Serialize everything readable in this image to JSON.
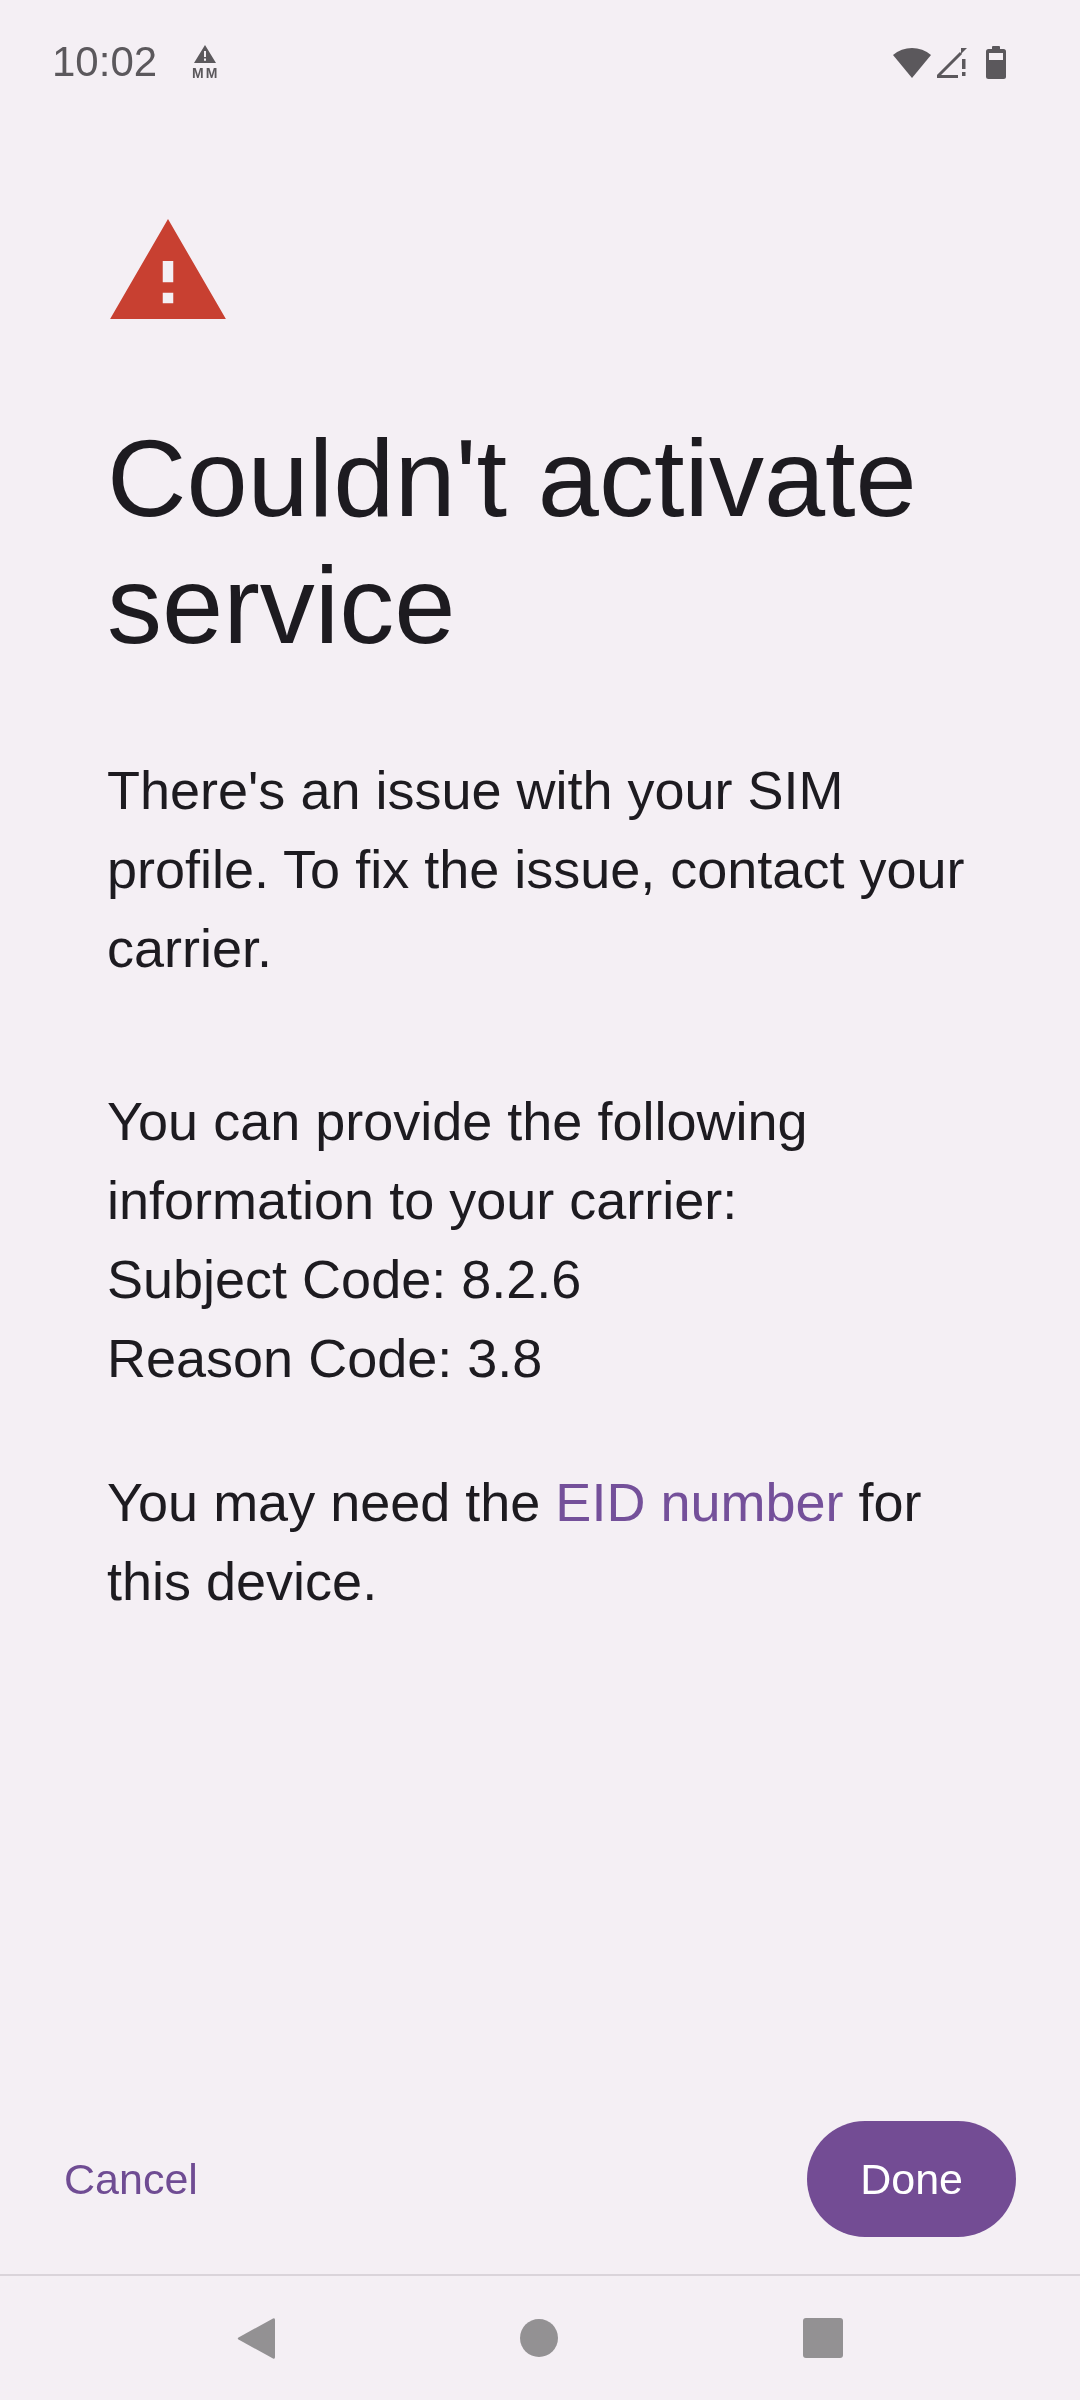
{
  "status_bar": {
    "time": "10:02",
    "notification_label": "MM"
  },
  "title": "Couldn't activate service",
  "issue_text": "There's an issue with your SIM profile. To fix the issue, contact your carrier.",
  "info": {
    "intro": "You can provide the following information to your carrier:",
    "codes": [
      "Subject Code: 8.2.6",
      "Reason Code: 3.8"
    ]
  },
  "eid_note": {
    "before": "You may need the ",
    "link": "EID number",
    "after": " for this device."
  },
  "buttons": [
    {
      "label": "Cancel",
      "kind": "text"
    },
    {
      "label": "Done",
      "kind": "filled"
    }
  ]
}
